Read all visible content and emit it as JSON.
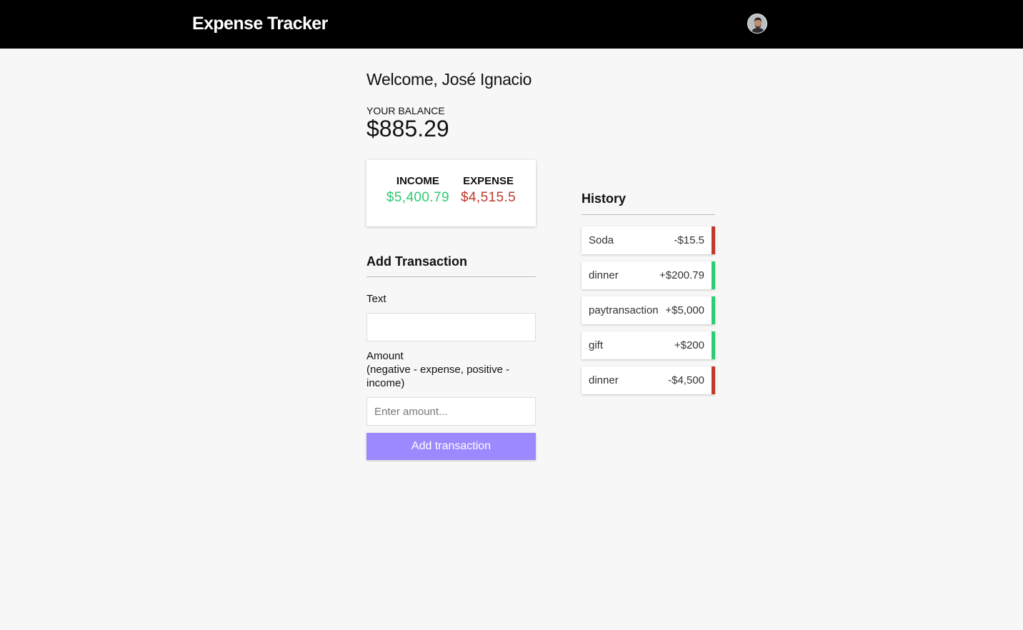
{
  "header": {
    "app_title": "Expense Tracker",
    "avatar_icon": "user-avatar"
  },
  "welcome": "Welcome, José Ignacio",
  "balance": {
    "label": "YOUR BALANCE",
    "value": "$885.29"
  },
  "summary": {
    "income_label": "INCOME",
    "income_value": "$5,400.79",
    "expense_label": "EXPENSE",
    "expense_value": "$4,515.5",
    "income_color": "#2ecc71",
    "expense_color": "#c0392b"
  },
  "add_transaction": {
    "title": "Add Transaction",
    "text_label": "Text",
    "text_value": "",
    "amount_label_line1": "Amount",
    "amount_label_line2": "(negative - expense, positive - income)",
    "amount_placeholder": "Enter amount...",
    "button_label": "Add transaction",
    "button_color": "#9c88ff"
  },
  "history": {
    "title": "History",
    "items": [
      {
        "text": "Soda",
        "amount": "-$15.5",
        "type": "minus"
      },
      {
        "text": "dinner",
        "amount": "+$200.79",
        "type": "plus"
      },
      {
        "text": "paytransaction",
        "amount": "+$5,000",
        "type": "plus"
      },
      {
        "text": "gift",
        "amount": "+$200",
        "type": "plus"
      },
      {
        "text": "dinner",
        "amount": "-$4,500",
        "type": "minus"
      }
    ]
  }
}
